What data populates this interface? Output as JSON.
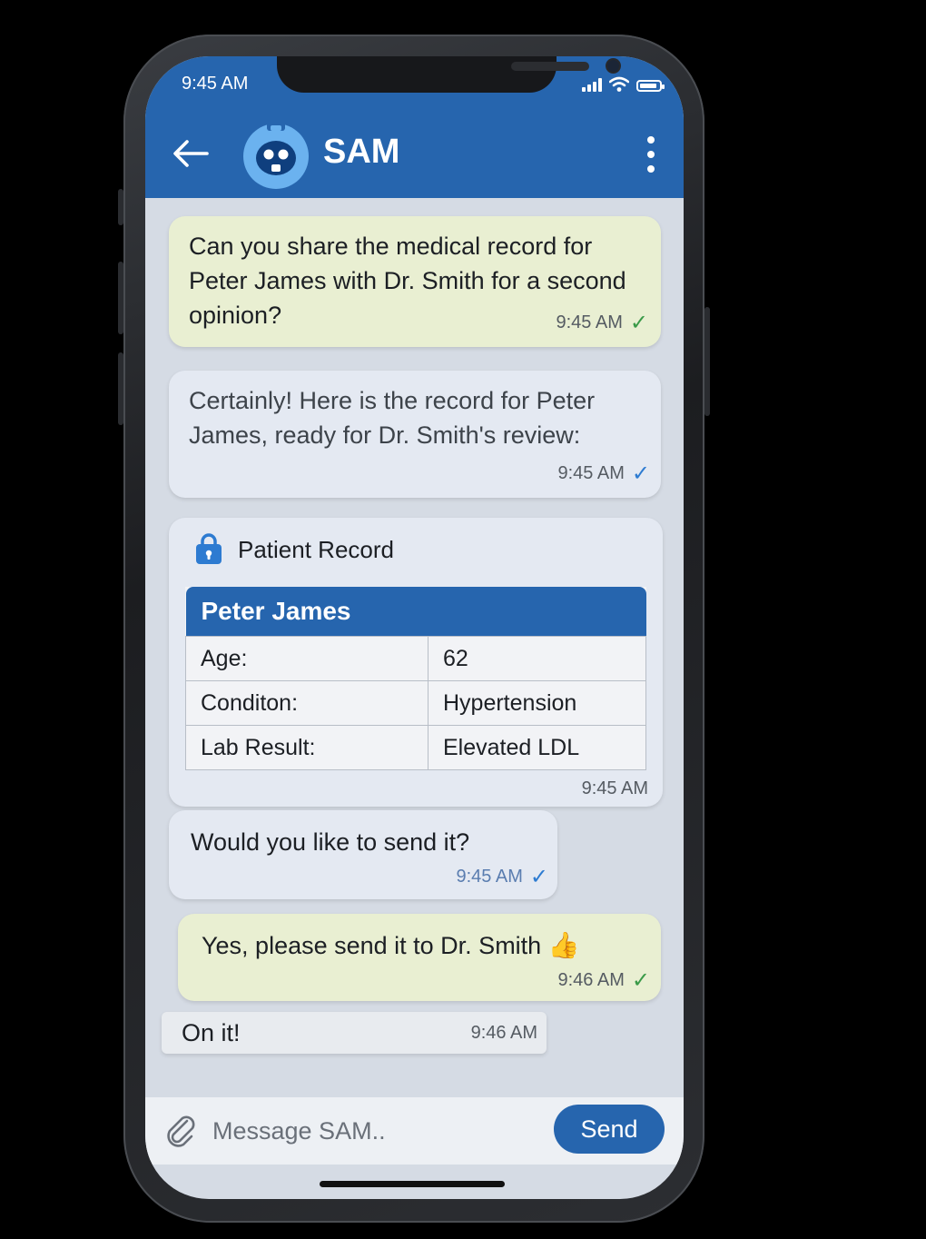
{
  "status_bar": {
    "time": "9:45 AM"
  },
  "header": {
    "title": "SAM",
    "back_icon": "arrow-left-icon",
    "menu_icon": "more-vertical-icon",
    "avatar_icon": "robot-icon"
  },
  "colors": {
    "brand": "#2665ae",
    "outgoing_bubble": "#e9efd2",
    "incoming_bubble": "#e4e9f2",
    "chat_bg": "#d5dbe4",
    "check_green": "#3a9a48",
    "check_blue": "#2d7bd1"
  },
  "messages": [
    {
      "direction": "outgoing",
      "text": "Can you share the medical record for Peter James with Dr. Smith for a second opinion?",
      "time": "9:45 AM",
      "status_icon": "check-icon"
    },
    {
      "direction": "incoming",
      "text": "Certainly! Here is the record for Peter James, ready for Dr. Smith's review:",
      "time": "9:45 AM",
      "status_icon": "check-icon"
    },
    {
      "direction": "incoming",
      "type": "record_card",
      "card_title": "Patient Record",
      "card_icon": "lock-icon",
      "patient_name": "Peter James",
      "rows": [
        {
          "label": "Age:",
          "value": "62"
        },
        {
          "label": "Conditon:",
          "value": "Hypertension"
        },
        {
          "label": "Lab Result:",
          "value": "Elevated LDL"
        }
      ],
      "time": "9:45 AM"
    },
    {
      "direction": "incoming",
      "text": "Would you like to send it?",
      "time": "9:45 AM",
      "status_icon": "check-icon"
    },
    {
      "direction": "outgoing",
      "text": "Yes, please send it to Dr. Smith",
      "emoji": "👍",
      "time": "9:46 AM",
      "status_icon": "check-icon"
    },
    {
      "direction": "incoming",
      "text": "On it!",
      "time": "9:46 AM"
    }
  ],
  "composer": {
    "placeholder": "Message SAM..",
    "send_label": "Send",
    "attach_icon": "paperclip-icon"
  }
}
